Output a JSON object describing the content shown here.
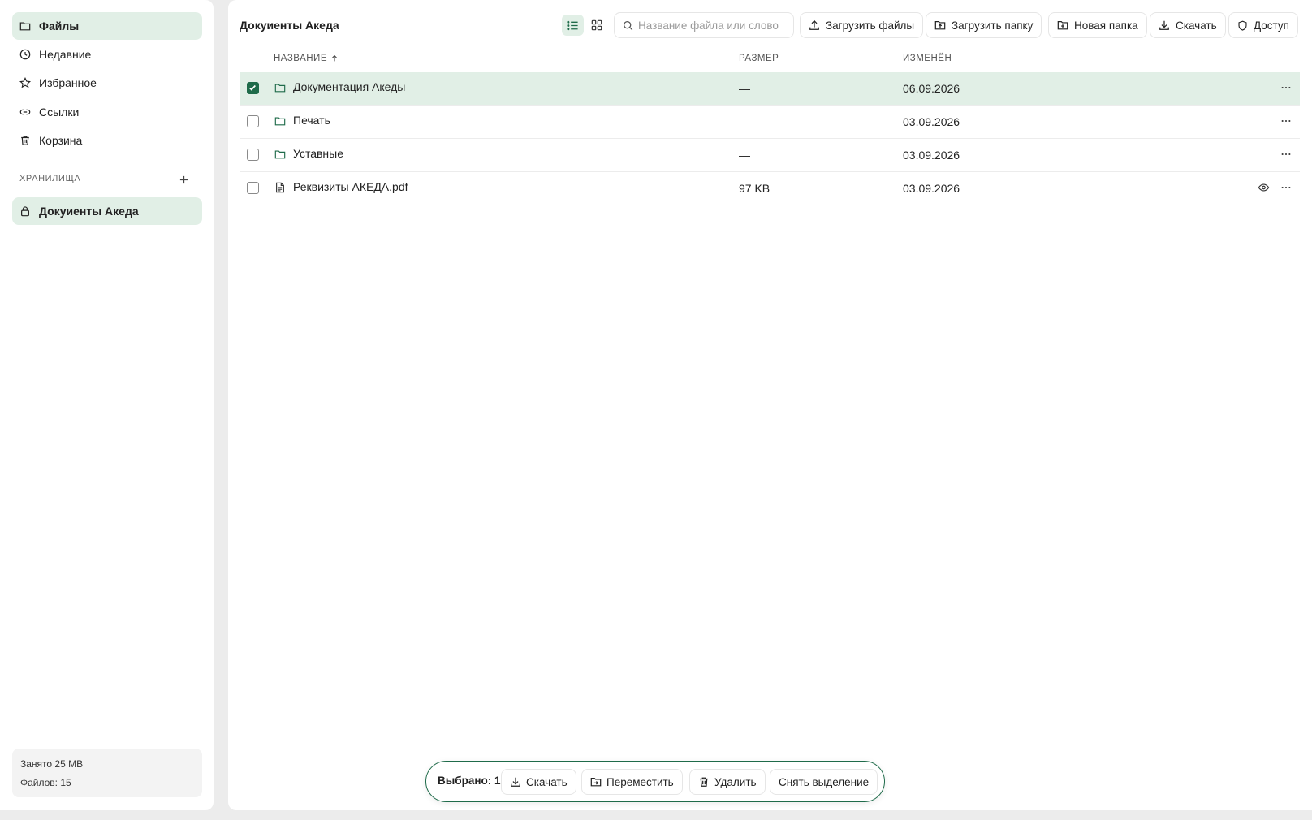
{
  "sidebar": {
    "items": [
      {
        "label": "Файлы",
        "icon": "folder-icon",
        "active": true
      },
      {
        "label": "Недавние",
        "icon": "clock-icon",
        "active": false
      },
      {
        "label": "Избранное",
        "icon": "star-icon",
        "active": false
      },
      {
        "label": "Ссылки",
        "icon": "link-icon",
        "active": false
      },
      {
        "label": "Корзина",
        "icon": "trash-icon",
        "active": false
      }
    ],
    "section_title": "ХРАНИЛИЩА",
    "storages": [
      {
        "label": "Докуиенты Акеда",
        "icon": "lock-icon",
        "active": true
      }
    ],
    "usage": {
      "used": "Занято 25 MB",
      "files": "Файлов: 15"
    }
  },
  "main": {
    "title": "Докуиенты Акеда",
    "search": {
      "placeholder": "Название файла или слово",
      "value": ""
    },
    "toolbar": {
      "upload_files": "Загрузить файлы",
      "upload_folder": "Загрузить папку",
      "new_folder": "Новая папка",
      "download": "Скачать",
      "access": "Доступ"
    },
    "columns": {
      "name": "НАЗВАНИЕ",
      "size": "РАЗМЕР",
      "modified": "ИЗМЕНЁН"
    },
    "rows": [
      {
        "name": "Документация Акеды",
        "type": "folder",
        "size": "—",
        "modified": "06.09.2026",
        "selected": true
      },
      {
        "name": "Печать",
        "type": "folder",
        "size": "—",
        "modified": "03.09.2026",
        "selected": false
      },
      {
        "name": "Уставные",
        "type": "folder",
        "size": "—",
        "modified": "03.09.2026",
        "selected": false
      },
      {
        "name": "Реквизиты АКЕДА.pdf",
        "type": "file",
        "size": "97 KB",
        "modified": "03.09.2026",
        "selected": false
      }
    ]
  },
  "selection_bar": {
    "count_label": "Выбрано: 1",
    "download": "Скачать",
    "move": "Переместить",
    "delete": "Удалить",
    "deselect": "Снять выделение"
  },
  "colors": {
    "accent": "#1f6b4a",
    "accent_light": "#e1efe6"
  }
}
